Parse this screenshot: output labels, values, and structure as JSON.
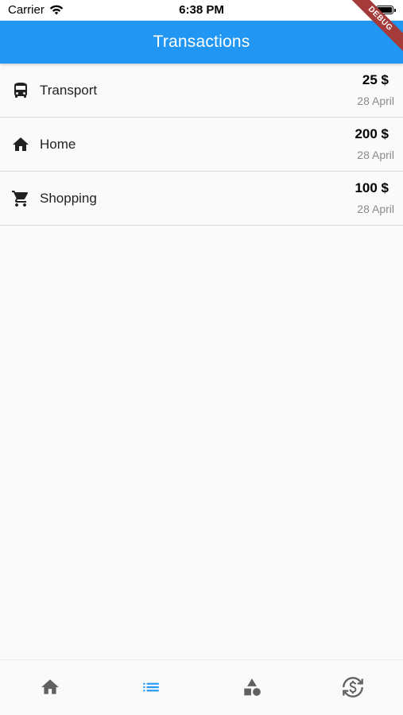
{
  "status_bar": {
    "carrier": "Carrier",
    "time": "6:38 PM"
  },
  "app_bar": {
    "title": "Transactions",
    "background": "#2196f3"
  },
  "debug_banner": "DEBUG",
  "transactions": [
    {
      "icon": "bus-icon",
      "label": "Transport",
      "amount": "25 $",
      "date": "28 April"
    },
    {
      "icon": "home-icon",
      "label": "Home",
      "amount": "200 $",
      "date": "28 April"
    },
    {
      "icon": "shopping-cart-icon",
      "label": "Shopping",
      "amount": "100 $",
      "date": "28 April"
    }
  ],
  "bottom_nav": [
    {
      "icon": "home-icon",
      "active": false
    },
    {
      "icon": "list-icon",
      "active": true
    },
    {
      "icon": "category-shapes-icon",
      "active": false
    },
    {
      "icon": "currency-exchange-icon",
      "active": false
    }
  ],
  "colors": {
    "active": "#2196f3",
    "inactive": "#616161"
  }
}
